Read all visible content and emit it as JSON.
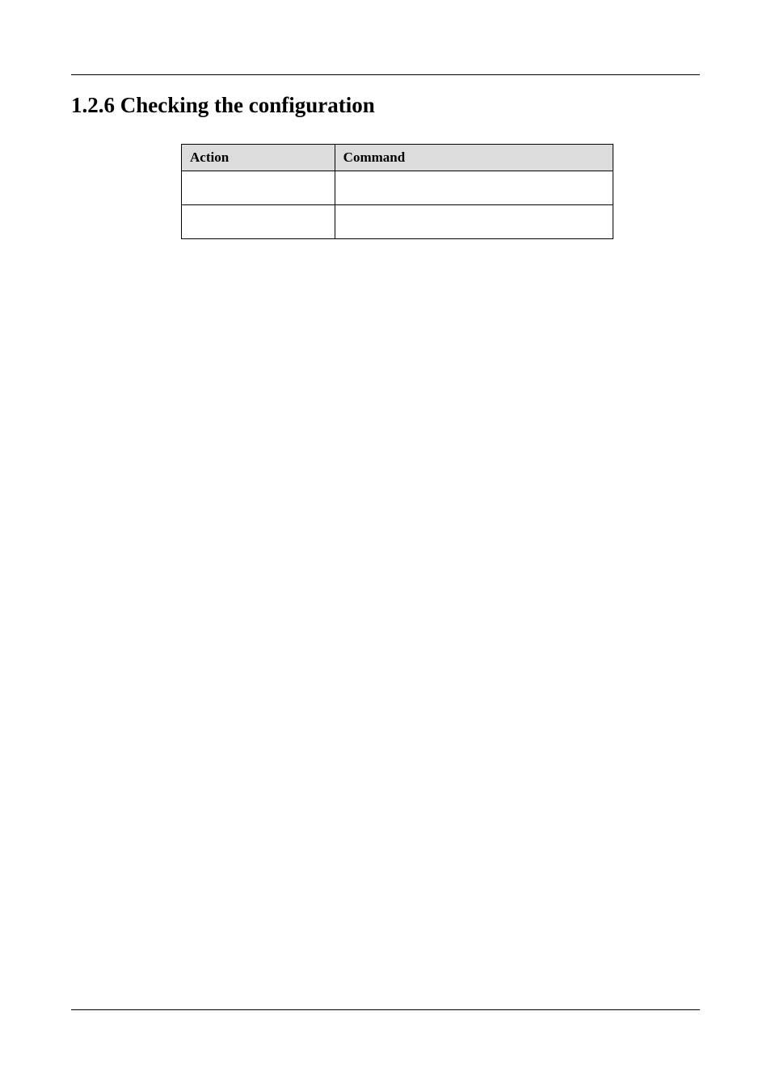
{
  "heading": "1.2.6 Checking the configuration",
  "table": {
    "headers": {
      "action": "Action",
      "command": "Command"
    },
    "rows": [
      {
        "action": "",
        "command": ""
      },
      {
        "action": "",
        "command": ""
      }
    ]
  }
}
